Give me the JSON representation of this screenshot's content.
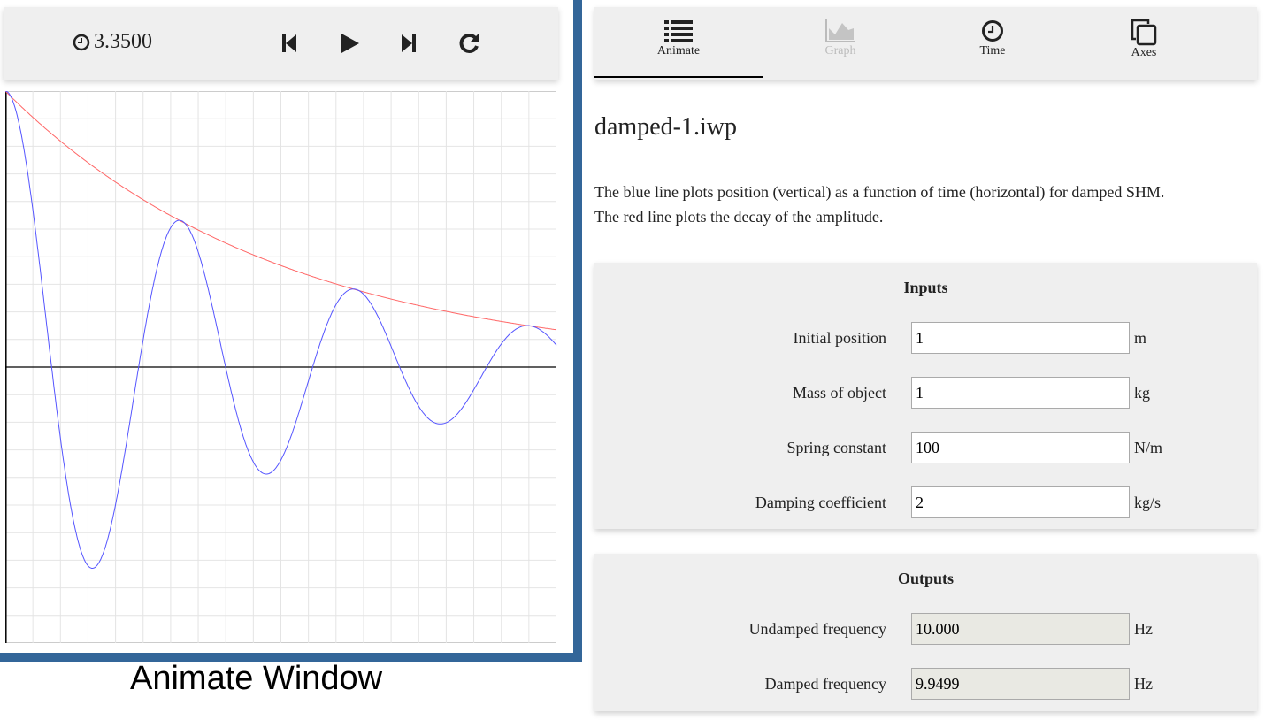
{
  "animate": {
    "time": "3.3500",
    "caption": "Animate Window"
  },
  "tabs": [
    {
      "label": "Animate",
      "icon": "list-icon",
      "active": true
    },
    {
      "label": "Graph",
      "icon": "area-chart-icon",
      "disabled": true
    },
    {
      "label": "Time",
      "icon": "clock-icon"
    },
    {
      "label": "Axes",
      "icon": "copy-icon"
    }
  ],
  "title": "damped-1.iwp",
  "description": [
    "The blue line plots position (vertical) as a function of time (horizontal) for damped SHM.",
    "The red line plots the decay of the amplitude."
  ],
  "inputs": {
    "heading": "Inputs",
    "fields": [
      {
        "label": "Initial position",
        "value": "1",
        "unit": "m"
      },
      {
        "label": "Mass of object",
        "value": "1",
        "unit": "kg"
      },
      {
        "label": "Spring constant",
        "value": "100",
        "unit": "N/m"
      },
      {
        "label": "Damping coefficient",
        "value": "2",
        "unit": "kg/s"
      }
    ]
  },
  "outputs": {
    "heading": "Outputs",
    "fields": [
      {
        "label": "Undamped frequency",
        "value": "10.000",
        "unit": "Hz"
      },
      {
        "label": "Damped frequency",
        "value": "9.9499",
        "unit": "Hz"
      }
    ]
  },
  "chart_data": {
    "type": "line",
    "xlim": [
      0,
      2
    ],
    "ylim": [
      -1,
      1
    ],
    "grid": true,
    "series": [
      {
        "color": "#5555ff",
        "function": "position"
      },
      {
        "color": "#ff6666",
        "function": "amplitude envelope"
      }
    ]
  }
}
